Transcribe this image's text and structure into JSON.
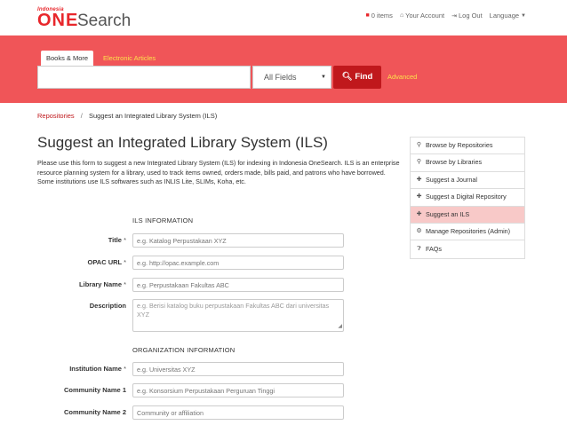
{
  "header": {
    "logo": {
      "small": "Indonesia",
      "one": "ONE",
      "search": "Search"
    },
    "nav": {
      "items_label": "0 items",
      "account_label": "Your Account",
      "logout_label": "Log Out",
      "language_label": "Language"
    }
  },
  "search": {
    "tabs": [
      "Books & More",
      "Electronic Articles"
    ],
    "input_value": "",
    "select_value": "All Fields",
    "find_label": "Find",
    "advanced_label": "Advanced"
  },
  "breadcrumb": {
    "parent": "Repositories",
    "separator": "/",
    "current": "Suggest an Integrated Library System (ILS)"
  },
  "page": {
    "title": "Suggest an Integrated Library System (ILS)",
    "intro": "Please use this form to suggest a new Integrated Library System (ILS) for indexing in Indonesia OneSearch. ILS is an enterprise resource planning system for a library, used to track items owned, orders made, bills paid, and patrons who have borrowed. Some institutions use ILS softwares such as INLIS Lite, SLIMs, Koha, etc."
  },
  "form": {
    "ils_heading": "ILS INFORMATION",
    "org_heading": "ORGANIZATION INFORMATION",
    "required_mark": "*",
    "fields": {
      "title": {
        "label": "Title",
        "placeholder": "e.g. Katalog Perpustakaan XYZ"
      },
      "opac_url": {
        "label": "OPAC URL",
        "placeholder": "e.g. http://opac.example.com"
      },
      "library_name": {
        "label": "Library Name",
        "placeholder": "e.g. Perpustakaan Fakultas ABC"
      },
      "description": {
        "label": "Description",
        "placeholder": "e.g. Berisi katalog buku perpustakaan Fakultas ABC dari universitas XYZ"
      },
      "institution_name": {
        "label": "Institution Name",
        "placeholder": "e.g. Universitas XYZ"
      },
      "community_name_1": {
        "label": "Community Name 1",
        "placeholder": "e.g. Konsorsium Perpustakaan Perguruan Tinggi"
      },
      "community_name_2": {
        "label": "Community Name 2",
        "placeholder": "Community or affiliation"
      }
    }
  },
  "sidebar": {
    "items": [
      {
        "icon": "search-icon",
        "label": "Browse by Repositories"
      },
      {
        "icon": "search-icon",
        "label": "Browse by Libraries"
      },
      {
        "icon": "plus-icon",
        "label": "Suggest a Journal"
      },
      {
        "icon": "plus-icon",
        "label": "Suggest a Digital Repository"
      },
      {
        "icon": "plus-icon",
        "label": "Suggest an ILS"
      },
      {
        "icon": "gear-icon",
        "label": "Manage Repositories (Admin)"
      },
      {
        "icon": "question-icon",
        "label": "FAQs"
      }
    ],
    "active_index": 4
  },
  "colors": {
    "brand_red": "#e8262b",
    "banner": "#f05558",
    "find_button": "#c0181c",
    "tab_link": "#fde24b",
    "active_sidebar": "#f8c9c8"
  }
}
